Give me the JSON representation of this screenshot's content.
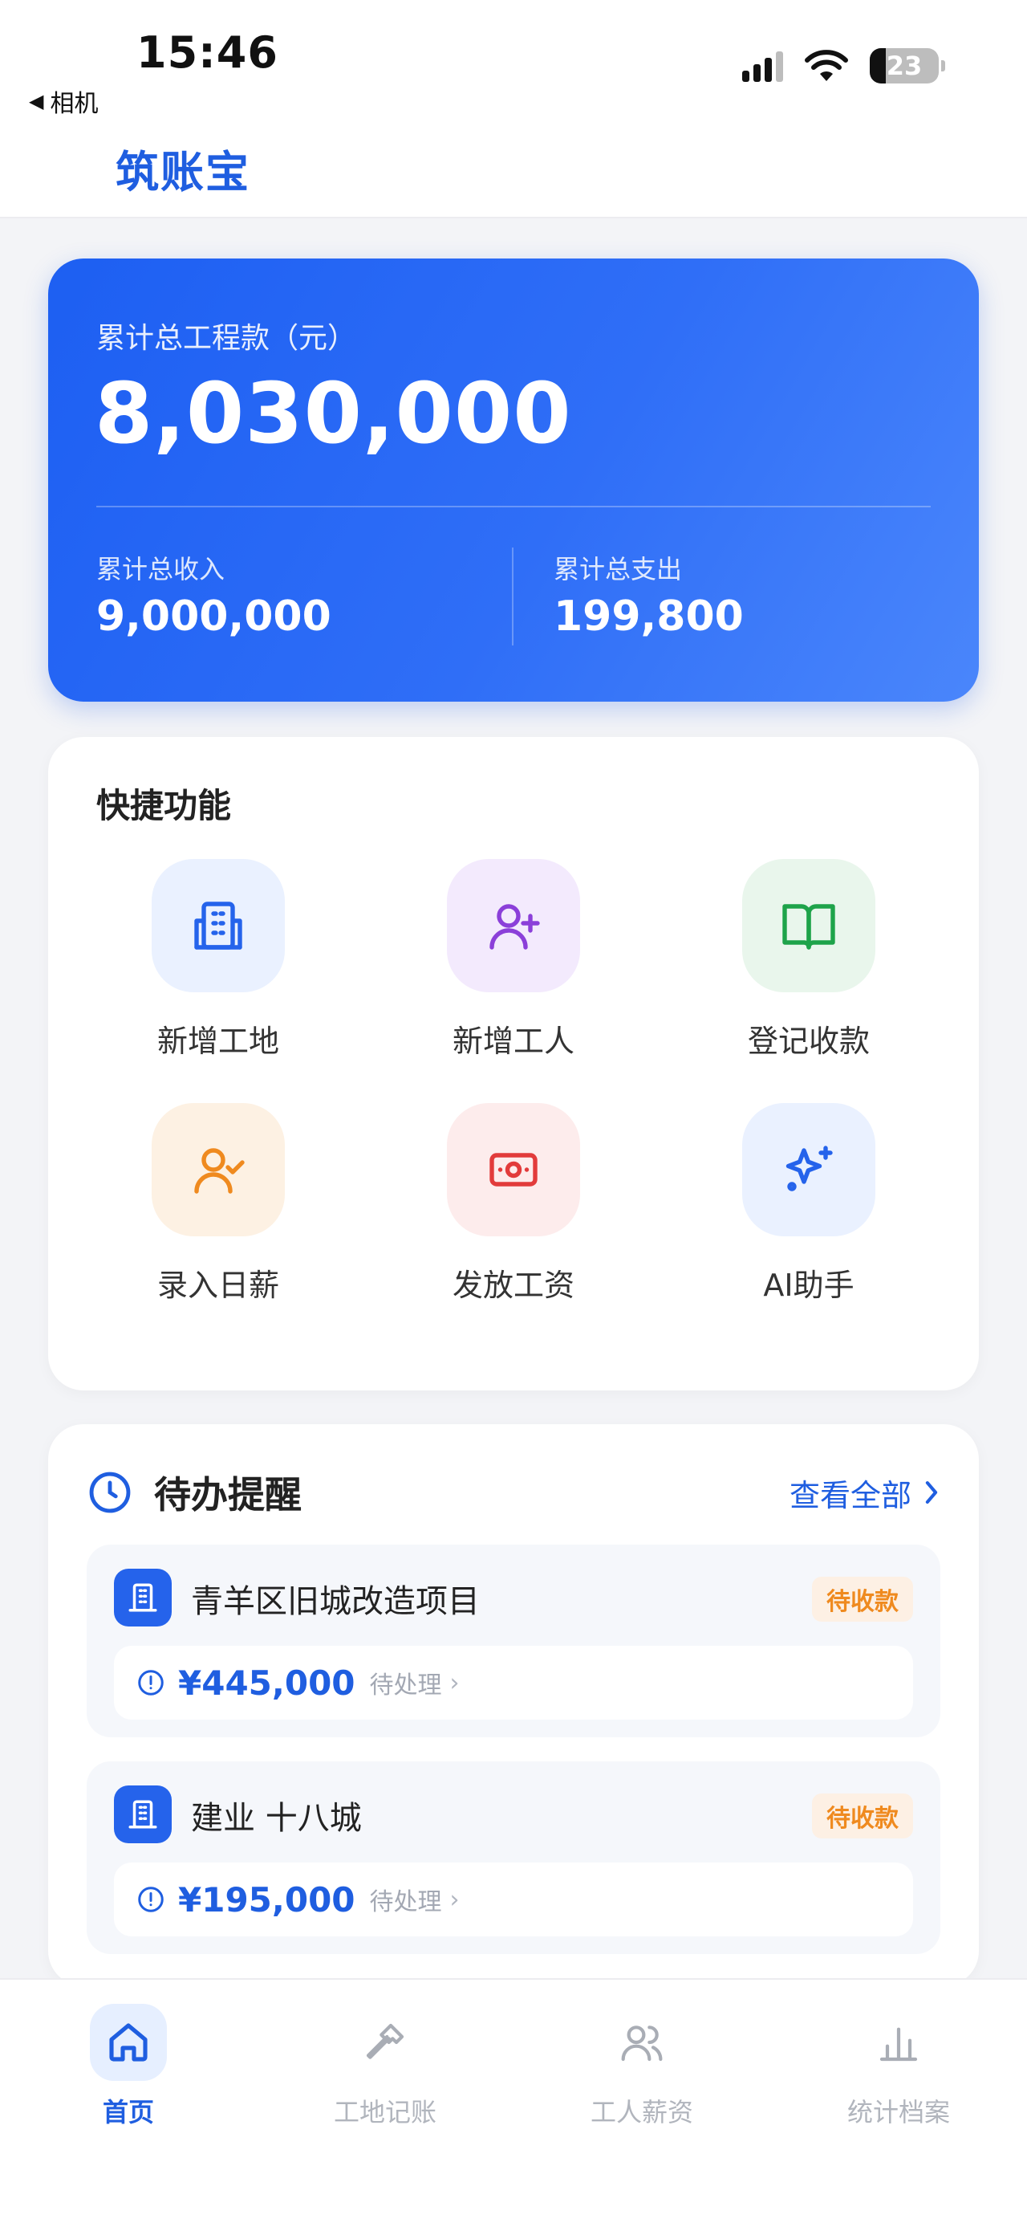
{
  "status_bar": {
    "time": "15:46",
    "back_label": "相机",
    "battery": "23",
    "battery_level": 0.23
  },
  "header": {
    "title": "筑账宝"
  },
  "summary": {
    "total_label": "累计总工程款（元）",
    "total_value": "8,030,000",
    "income_label": "累计总收入",
    "income_value": "9,000,000",
    "expense_label": "累计总支出",
    "expense_value": "199,800"
  },
  "quick": {
    "title": "快捷功能",
    "items": [
      {
        "label": "新增工地",
        "icon": "building-icon"
      },
      {
        "label": "新增工人",
        "icon": "user-plus-icon"
      },
      {
        "label": "登记收款",
        "icon": "book-open-icon"
      },
      {
        "label": "录入日薪",
        "icon": "user-check-icon"
      },
      {
        "label": "发放工资",
        "icon": "banknote-icon"
      },
      {
        "label": "AI助手",
        "icon": "sparkles-icon"
      }
    ]
  },
  "todo": {
    "title": "待办提醒",
    "view_all": "查看全部",
    "items": [
      {
        "name": "青羊区旧城改造项目",
        "badge": "待收款",
        "amount": "¥445,000",
        "status": "待处理"
      },
      {
        "name": "建业 十八城",
        "badge": "待收款",
        "amount": "¥195,000",
        "status": "待处理"
      }
    ]
  },
  "tabs": [
    {
      "label": "首页",
      "icon": "home-icon",
      "active": true
    },
    {
      "label": "工地记账",
      "icon": "hammer-icon",
      "active": false
    },
    {
      "label": "工人薪资",
      "icon": "users-icon",
      "active": false
    },
    {
      "label": "统计档案",
      "icon": "bar-chart-icon",
      "active": false
    }
  ],
  "colors": {
    "brand": "#1f5ee0",
    "badge_orange": "#ef8a1f"
  }
}
